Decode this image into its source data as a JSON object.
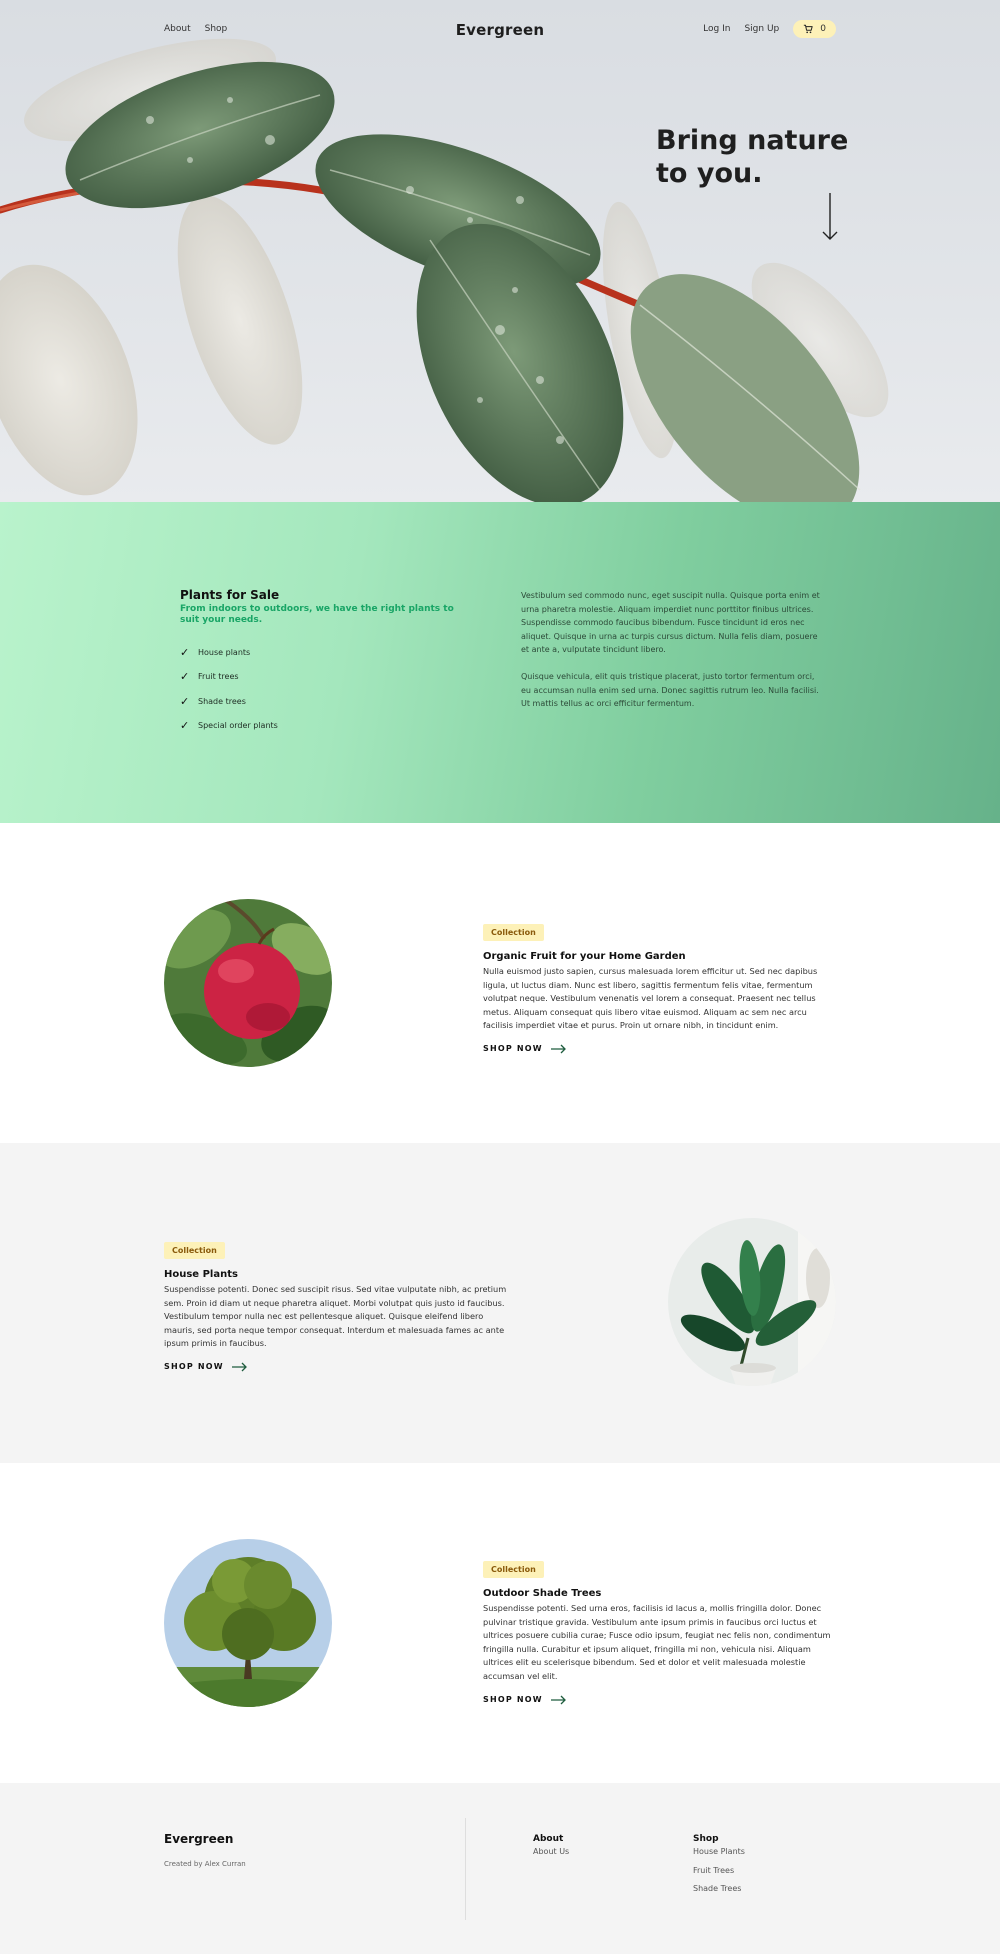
{
  "nav": {
    "links": [
      "About",
      "Shop"
    ],
    "brand": "Evergreen",
    "login": "Log In",
    "signup": "Sign Up",
    "cart_count": "0"
  },
  "hero": {
    "title": "Bring nature to you."
  },
  "info": {
    "title": "Plants for Sale",
    "subtitle": "From indoors to outdoors, we have the right plants to suit your needs.",
    "checklist": [
      "House plants",
      "Fruit trees",
      "Shade trees",
      "Special order plants"
    ],
    "paragraphs": [
      "Vestibulum sed commodo nunc, eget suscipit nulla. Quisque porta enim et urna pharetra molestie. Aliquam imperdiet nunc porttitor finibus ultrices. Suspendisse commodo faucibus bibendum. Fusce tincidunt id eros nec aliquet. Quisque in urna ac turpis cursus dictum. Nulla felis diam, posuere et ante a, vulputate tincidunt libero.",
      "Quisque vehicula, elit quis tristique placerat, justo tortor fermentum orci, eu accumsan nulla enim sed urna. Donec sagittis rutrum leo. Nulla facilisi. Ut mattis tellus ac orci efficitur fermentum."
    ]
  },
  "features": [
    {
      "badge": "Collection",
      "title": "Organic Fruit for your Home Garden",
      "description": "Nulla euismod justo sapien, cursus malesuada lorem efficitur ut. Sed nec dapibus ligula, ut luctus diam. Nunc est libero, sagittis fermentum felis vitae, fermentum volutpat neque. Vestibulum venenatis vel lorem a consequat. Praesent nec tellus metus. Aliquam consequat quis libero vitae euismod. Aliquam ac sem nec arcu facilisis imperdiet vitae et purus. Proin ut ornare nibh, in tincidunt enim.",
      "cta": "SHOP NOW"
    },
    {
      "badge": "Collection",
      "title": "House Plants",
      "description": "Suspendisse potenti. Donec sed suscipit risus. Sed vitae vulputate nibh, ac pretium sem. Proin id diam ut neque pharetra aliquet. Morbi volutpat quis justo id faucibus. Vestibulum tempor nulla nec est pellentesque aliquet. Quisque eleifend libero mauris, sed porta neque tempor consequat. Interdum et malesuada fames ac ante ipsum primis in faucibus.",
      "cta": "SHOP NOW"
    },
    {
      "badge": "Collection",
      "title": "Outdoor Shade Trees",
      "description": "Suspendisse potenti. Sed urna eros, facilisis id lacus a, mollis fringilla dolor. Donec pulvinar tristique gravida. Vestibulum ante ipsum primis in faucibus orci luctus et ultrices posuere cubilia curae; Fusce odio ipsum, feugiat nec felis non, condimentum fringilla nulla. Curabitur et ipsum aliquet, fringilla mi non, vehicula nisi. Aliquam ultrices elit eu scelerisque bibendum. Sed et dolor et velit malesuada molestie accumsan vel elit.",
      "cta": "SHOP NOW"
    }
  ],
  "footer": {
    "brand": "Evergreen",
    "credit": "Created by Alex Curran",
    "columns": [
      {
        "heading": "About",
        "links": [
          "About Us"
        ]
      },
      {
        "heading": "Shop",
        "links": [
          "House Plants",
          "Fruit Trees",
          "Shade Trees"
        ]
      }
    ]
  },
  "colors": {
    "accent_green": "#19a566",
    "badge_yellow": "#fdf1b8",
    "badge_text": "#8a5a0c"
  },
  "icons": [
    "cart-icon",
    "arrow-down-icon",
    "check-icon",
    "arrow-right-icon"
  ]
}
